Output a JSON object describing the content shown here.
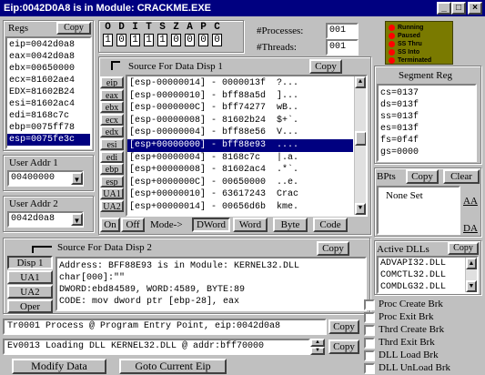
{
  "window": {
    "title": "Eip:0042D0A8 is in Module: CRACKME.EXE"
  },
  "regs": {
    "label": "Regs",
    "copy_label": "Copy",
    "items": [
      "eip=0042d0a8",
      "eax=0042d0a8",
      "ebx=00650000",
      "ecx=81602ae4",
      "EDX=81602B24",
      "esi=81602ac4",
      "edi=8168c7c",
      "ebp=0075ff78",
      "esp=0075fe3c"
    ],
    "selected_index": 8
  },
  "flags": {
    "labels": [
      "O",
      "D",
      "I",
      "T",
      "S",
      "Z",
      "A",
      "P",
      "C"
    ],
    "values": [
      "1",
      "0",
      "1",
      "1",
      "1",
      "0",
      "0",
      "0",
      "0"
    ]
  },
  "counts": {
    "processes_label": "#Processes:",
    "processes_value": "001",
    "threads_label": "#Threads:",
    "threads_value": "001"
  },
  "legend": {
    "items": [
      {
        "label": "Running",
        "color": "#ff0000"
      },
      {
        "label": "Paused",
        "color": "#ff0000"
      },
      {
        "label": "SS Thru",
        "color": "#ff0000"
      },
      {
        "label": "SS Into",
        "color": "#ff0000"
      },
      {
        "label": "Terminated",
        "color": "#ff0000"
      }
    ]
  },
  "disp1": {
    "title": "Source For Data Disp 1",
    "copy_label": "Copy",
    "reg_buttons": [
      "eip",
      "eax",
      "ebx",
      "ecx",
      "edx",
      "esi",
      "edi",
      "ebp",
      "esp",
      "UA1",
      "UA2"
    ],
    "lines": [
      "[esp-00000014] - 0000013f  ?...",
      "[esp-00000010] - bff88a5d  ]...",
      "[esp-0000000C] - bff74277  wB..",
      "[esp-00000008] - 81602b24  $+`.",
      "[esp-00000004] - bff88e56  V...",
      "[esp+00000000] - bff88e93  ....",
      "[esp+00000004] - 8168c7c   |.a.",
      "[esp+00000008] - 81602ac4  .*`.",
      "[esp+0000000C] - 00650000  ..e.",
      "[esp+00000010] - 63617243  Crac",
      "[esp+00000014] - 00656d6b  kme."
    ],
    "selected_index": 5,
    "on_label": "On",
    "off_label": "Off",
    "mode_label": "Mode->",
    "dword_label": "DWord",
    "word_label": "Word",
    "byte_label": "Byte",
    "code_label": "Code"
  },
  "segments": {
    "label": "Segment Reg",
    "items": [
      "cs=0137",
      "ds=013f",
      "ss=013f",
      "es=013f",
      "fs=0f4f",
      "gs=0000"
    ]
  },
  "bpts": {
    "label": "BPts",
    "copy_label": "Copy",
    "clear_label": "Clear",
    "none_set": "None Set",
    "aa_label": "AA",
    "da_label": "DA"
  },
  "user_addr1": {
    "label": "User Addr 1",
    "value": "00400000"
  },
  "user_addr2": {
    "label": "User Addr 2",
    "value": "0042d0a8"
  },
  "disp2": {
    "title": "Source For Data Disp 2",
    "copy_label": "Copy",
    "buttons": [
      "Disp 1",
      "UA1",
      "UA2",
      "Oper"
    ],
    "lines": [
      "Address: BFF88E93 is in Module: KERNEL32.DLL",
      "char[000]:\"\"",
      "DWORD:ebd84589, WORD:4589, BYTE:89",
      "CODE: mov dword ptr [ebp-28], eax"
    ]
  },
  "dlls": {
    "label": "Active DLLs",
    "copy_label": "Copy",
    "items": [
      "ADVAPI32.DLL",
      "COMCTL32.DLL",
      "COMDLG32.DLL"
    ]
  },
  "events": {
    "line1": "Tr0001 Process @ Program Entry Point, eip:0042d0a8",
    "line2": "Ev0013 Loading DLL KERNEL32.DLL @ addr:bff70000",
    "copy_label": "Copy"
  },
  "checks": [
    "Proc Create Brk",
    "Proc Exit Brk",
    "Thrd Create Brk",
    "Thrd Exit Brk",
    "DLL Load Brk",
    "DLL UnLoad Brk"
  ],
  "bottom": {
    "modify_label": "Modify Data",
    "goto_label": "Goto Current Eip"
  }
}
